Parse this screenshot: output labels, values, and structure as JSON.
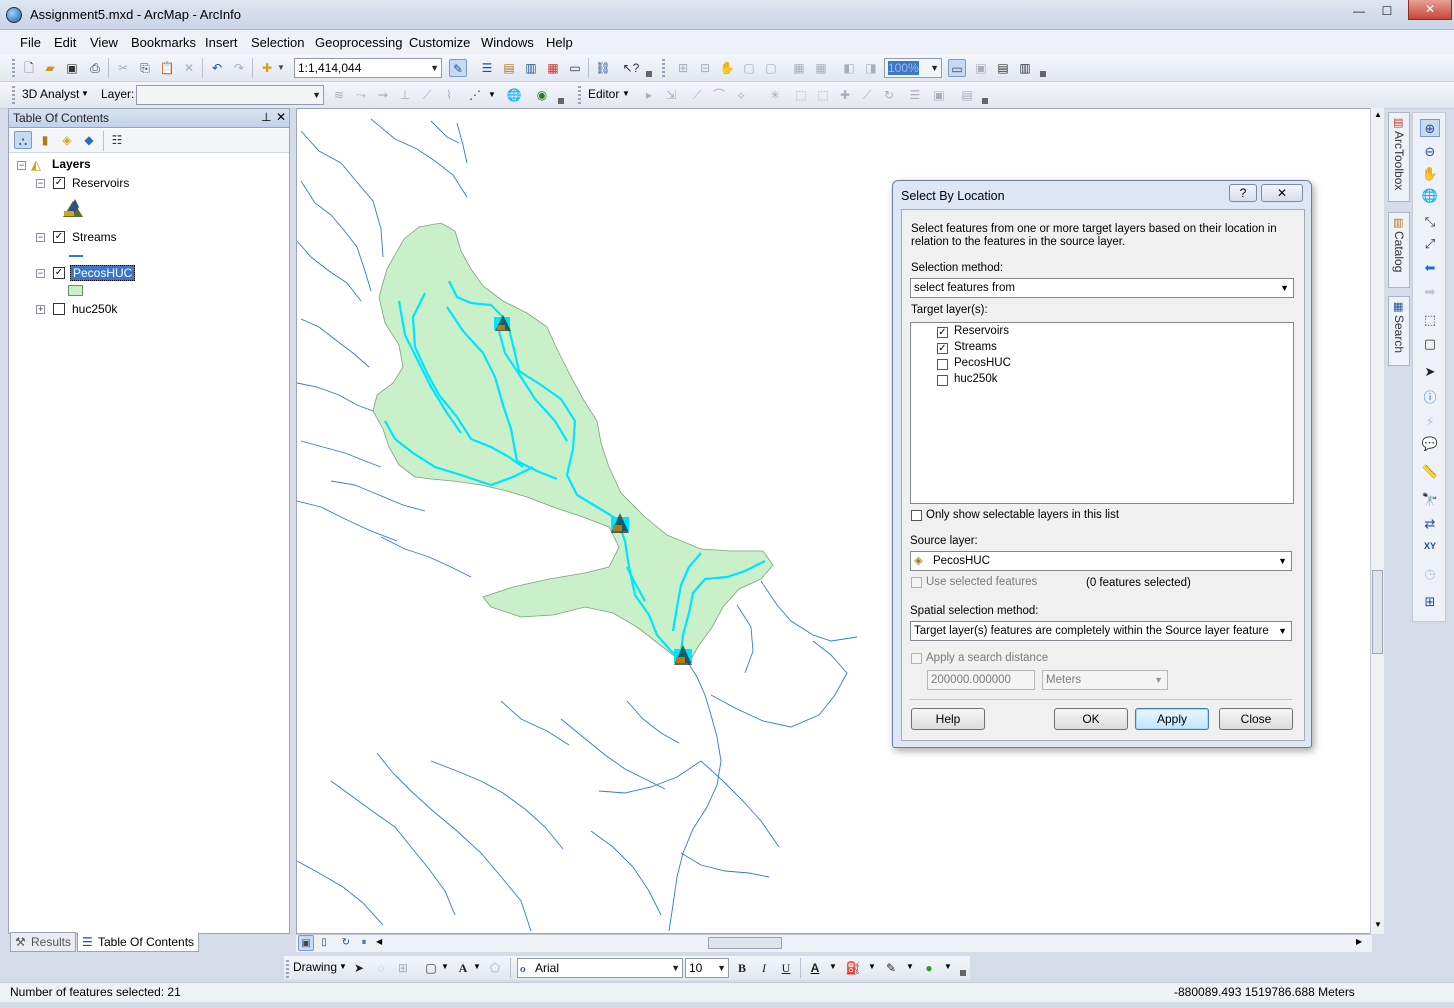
{
  "window": {
    "title": "Assignment5.mxd - ArcMap - ArcInfo",
    "controls": {
      "minimize": "—",
      "maximize": "☐",
      "close": "✕"
    }
  },
  "menus": [
    "File",
    "Edit",
    "View",
    "Bookmarks",
    "Insert",
    "Selection",
    "Geoprocessing",
    "Customize",
    "Windows",
    "Help"
  ],
  "toolbar": {
    "scale": "1:1,414,044",
    "zoom_percent": "100%",
    "analyst_label": "3D Analyst",
    "layer_label": "Layer:",
    "layer_value": "",
    "editor_label": "Editor"
  },
  "toc": {
    "title": "Table Of Contents",
    "root": "Layers",
    "layers": [
      {
        "name": "Reservoirs",
        "checked": true,
        "expanded": true
      },
      {
        "name": "Streams",
        "checked": true,
        "expanded": true
      },
      {
        "name": "PecosHUC",
        "checked": true,
        "expanded": true
      },
      {
        "name": "huc250k",
        "checked": false,
        "expanded": false
      }
    ],
    "tabs": {
      "results": "Results",
      "toc": "Table Of Contents"
    }
  },
  "right_dock": {
    "tabs": [
      "ArcToolbox",
      "Catalog",
      "Search"
    ]
  },
  "dialog": {
    "title": "Select By Location",
    "help_glyph": "?",
    "close_glyph": "✕",
    "description": "Select features from one or more target layers based on their location in relation to the features in the source layer.",
    "selection_method_label": "Selection method:",
    "selection_method": "select features from",
    "target_layers_label": "Target layer(s):",
    "target_layers": [
      {
        "name": "Reservoirs",
        "checked": true
      },
      {
        "name": "Streams",
        "checked": true
      },
      {
        "name": "PecosHUC",
        "checked": false
      },
      {
        "name": "huc250k",
        "checked": false
      }
    ],
    "only_selectable_label": "Only show selectable layers in this list",
    "source_layer_label": "Source layer:",
    "source_layer": "PecosHUC",
    "use_selected_label": "Use selected features",
    "features_selected": "(0 features selected)",
    "spatial_method_label": "Spatial selection method:",
    "spatial_method": "Target layer(s) features are completely within the Source layer feature",
    "search_distance_label": "Apply a search distance",
    "search_distance_value": "200000.000000",
    "search_distance_unit": "Meters",
    "buttons": {
      "help": "Help",
      "ok": "OK",
      "apply": "Apply",
      "close": "Close"
    }
  },
  "drawing": {
    "label": "Drawing",
    "font": "Arial",
    "font_size": "10",
    "bold": "B",
    "italic": "I",
    "underline": "U"
  },
  "status": {
    "selected": "Number of features selected: 21",
    "coords": "-880089.493  1519786.688 Meters"
  },
  "colors": {
    "watershed_fill": "#c9f0c9",
    "stream_major": "#00e5ff",
    "stream_minor": "#2f78e0",
    "accent": "#3c7fb1"
  }
}
